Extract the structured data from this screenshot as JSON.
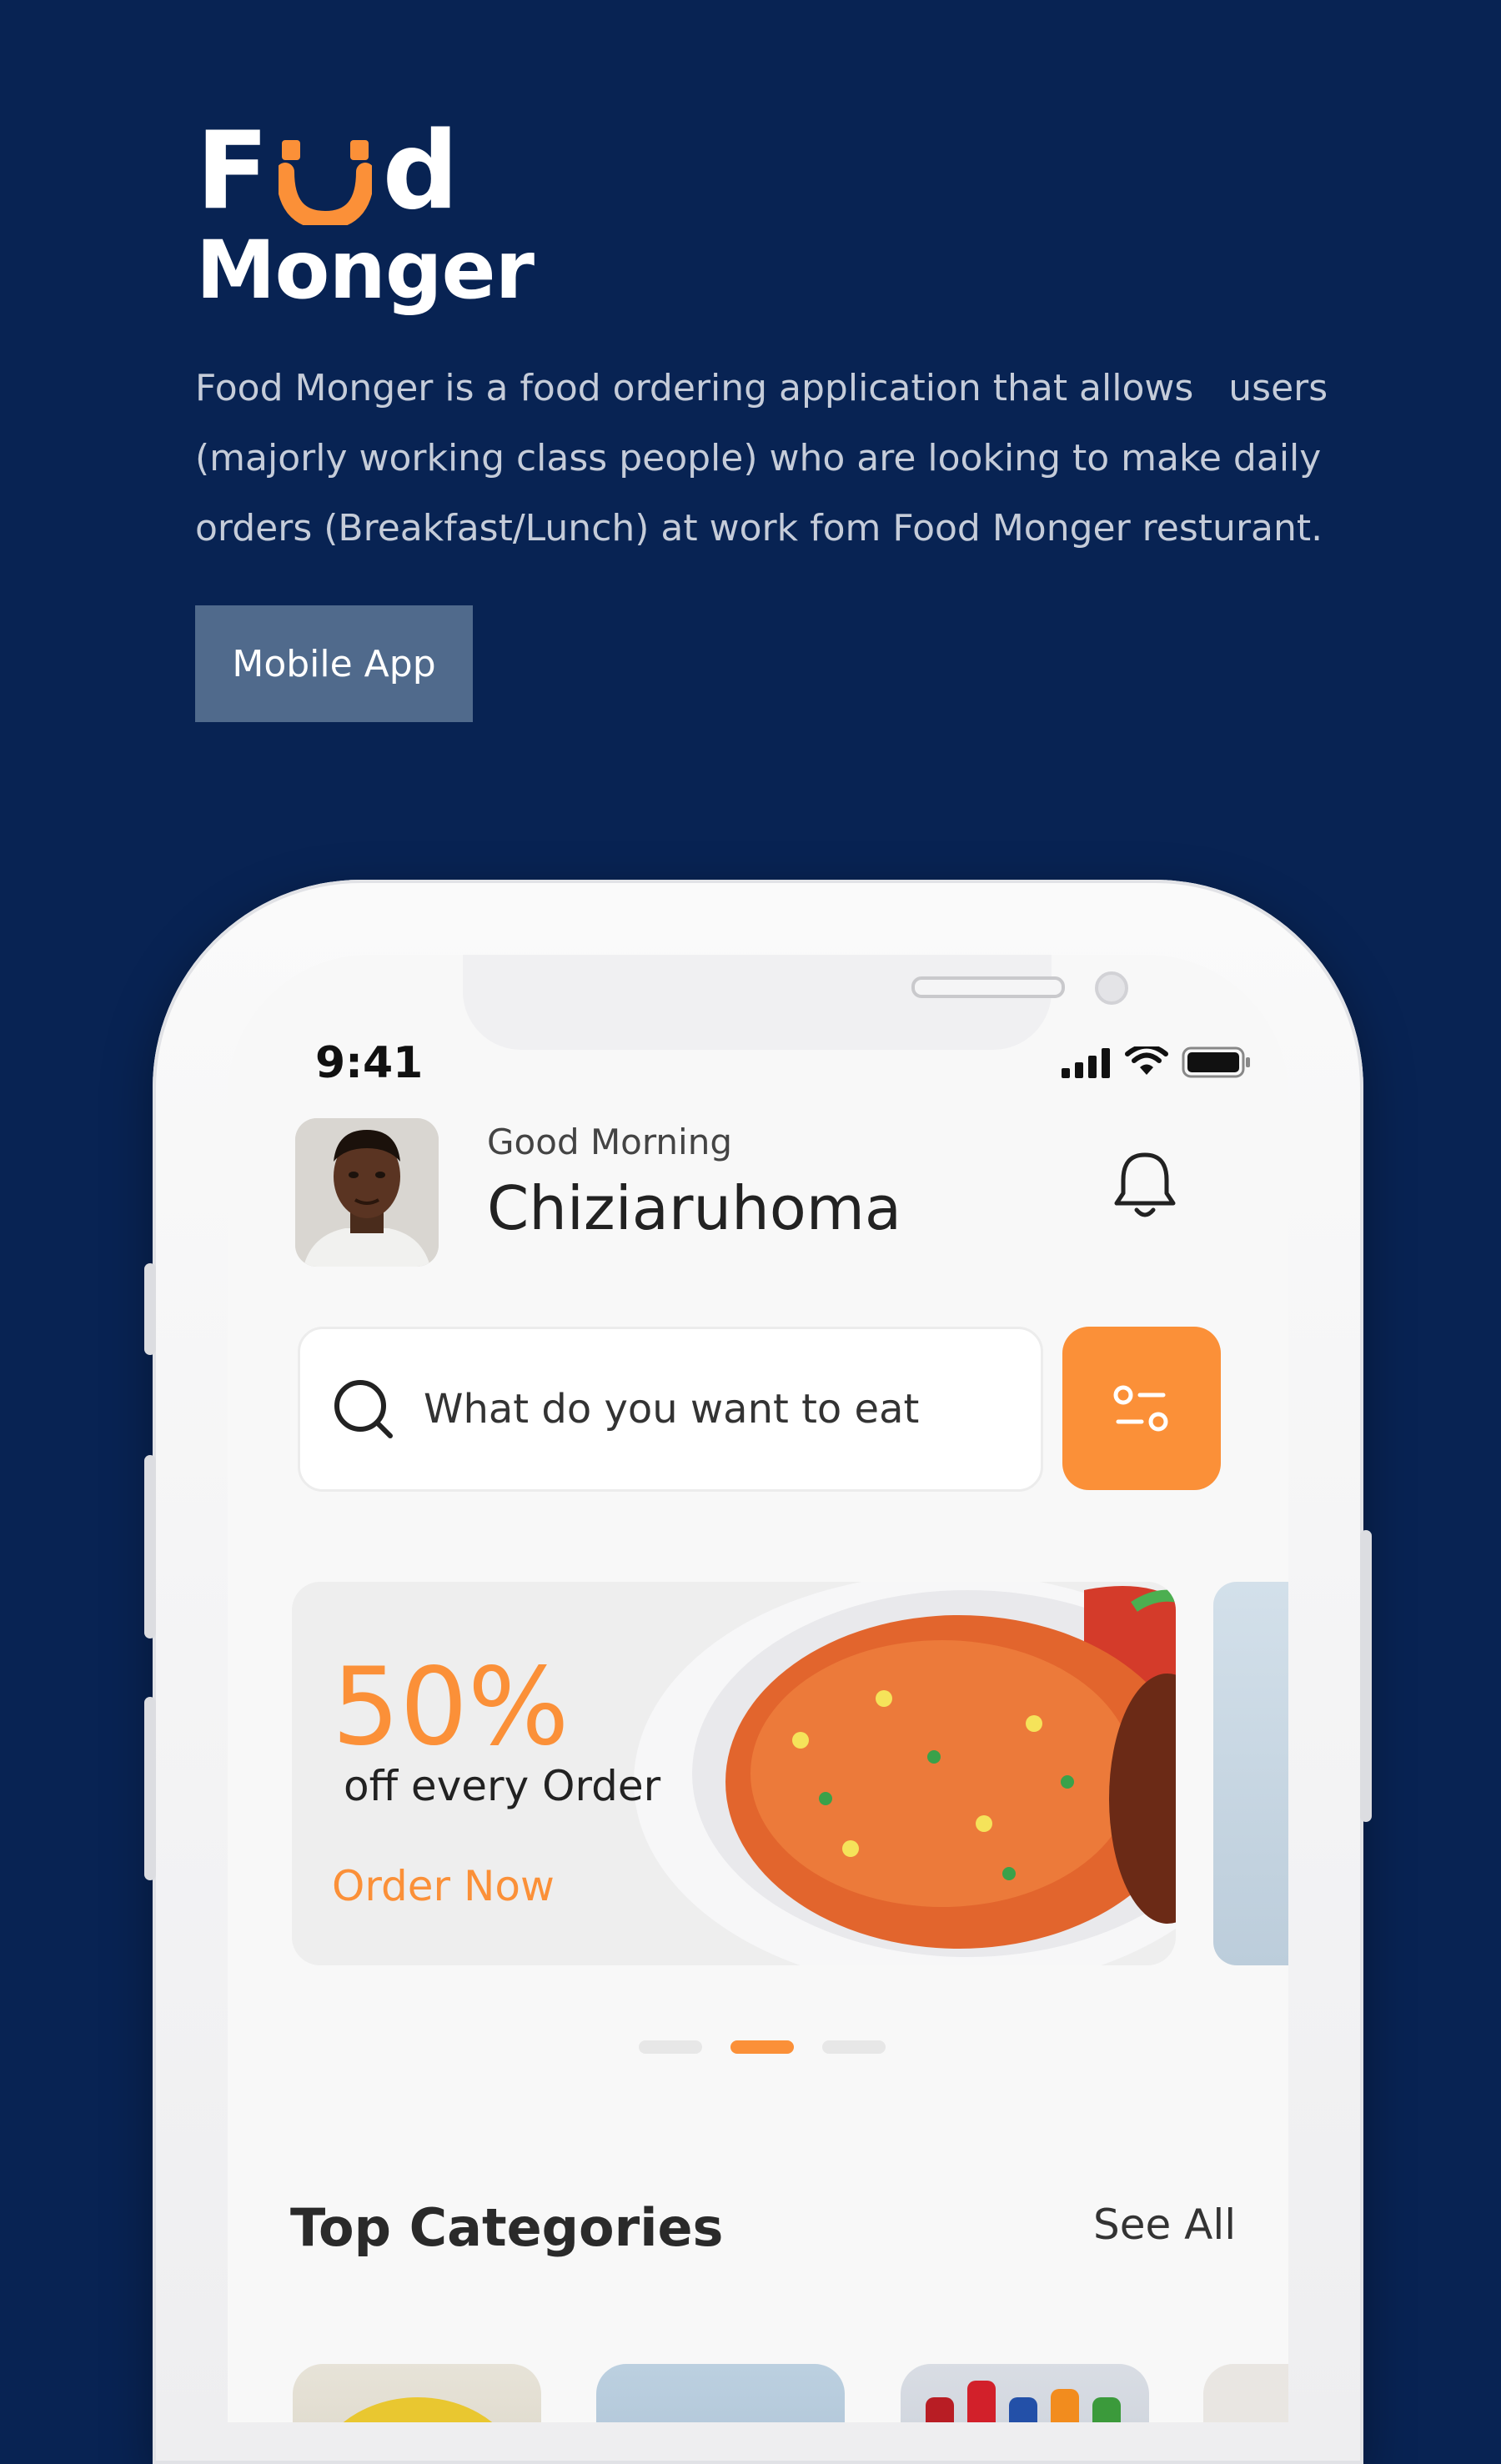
{
  "brand": {
    "logo_word_left": "F",
    "logo_word_right": "d",
    "logo_word_bottom": "Monger",
    "accent_color": "#FB9038",
    "background_color": "#082353"
  },
  "intro": {
    "description": "Food Monger is a food ordering application that allows   users (majorly working class people) who are looking to make daily orders (Breakfast/Lunch) at work fom Food Monger resturant.",
    "tag_label": "Mobile App"
  },
  "phone": {
    "status_bar": {
      "time": "9:41",
      "icons": [
        "signal-icon",
        "wifi-icon",
        "battery-icon"
      ]
    },
    "header": {
      "greeting": "Good Morning",
      "user_name": "Chiziaruhoma",
      "notification_icon": "bell-icon"
    },
    "search": {
      "placeholder": "What do you want to eat",
      "filter_icon": "filter-icon"
    },
    "promo_banner": {
      "discount": "50%",
      "subtitle": "off every Order",
      "cta_label": "Order Now"
    },
    "carousel": {
      "total": 3,
      "active_index": 1
    },
    "categories": {
      "title": "Top Categories",
      "see_all_label": "See All"
    }
  }
}
